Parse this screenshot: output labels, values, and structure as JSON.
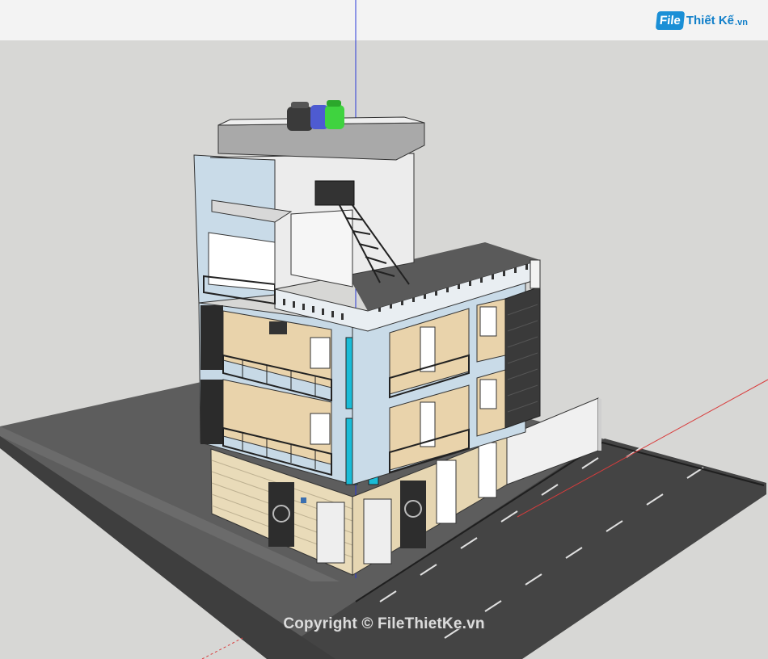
{
  "watermark": {
    "logo_badge": "File",
    "logo_brand": "Thiết Kế",
    "logo_tld": ".vn",
    "copyright": "Copyright © FileThietKe.vn"
  },
  "colors": {
    "sky": "#f3f3f3",
    "ground": "#d7d7d5",
    "road": "#454545",
    "lot": "#5a5a5a",
    "wall_white": "#f2f2f2",
    "wall_blue": "#c9dbe8",
    "wall_beige": "#e9d3ab",
    "glass_cyan": "#19bcd7",
    "axis_blue": "#2a38d8",
    "axis_red": "#d83c3c",
    "tank_black": "#3a3a3a",
    "tank_blue": "#4e5bd1",
    "tank_green": "#3fd33f"
  },
  "icons": [
    "axis-blue-icon",
    "axis-red-icon",
    "water-tank-icon"
  ]
}
